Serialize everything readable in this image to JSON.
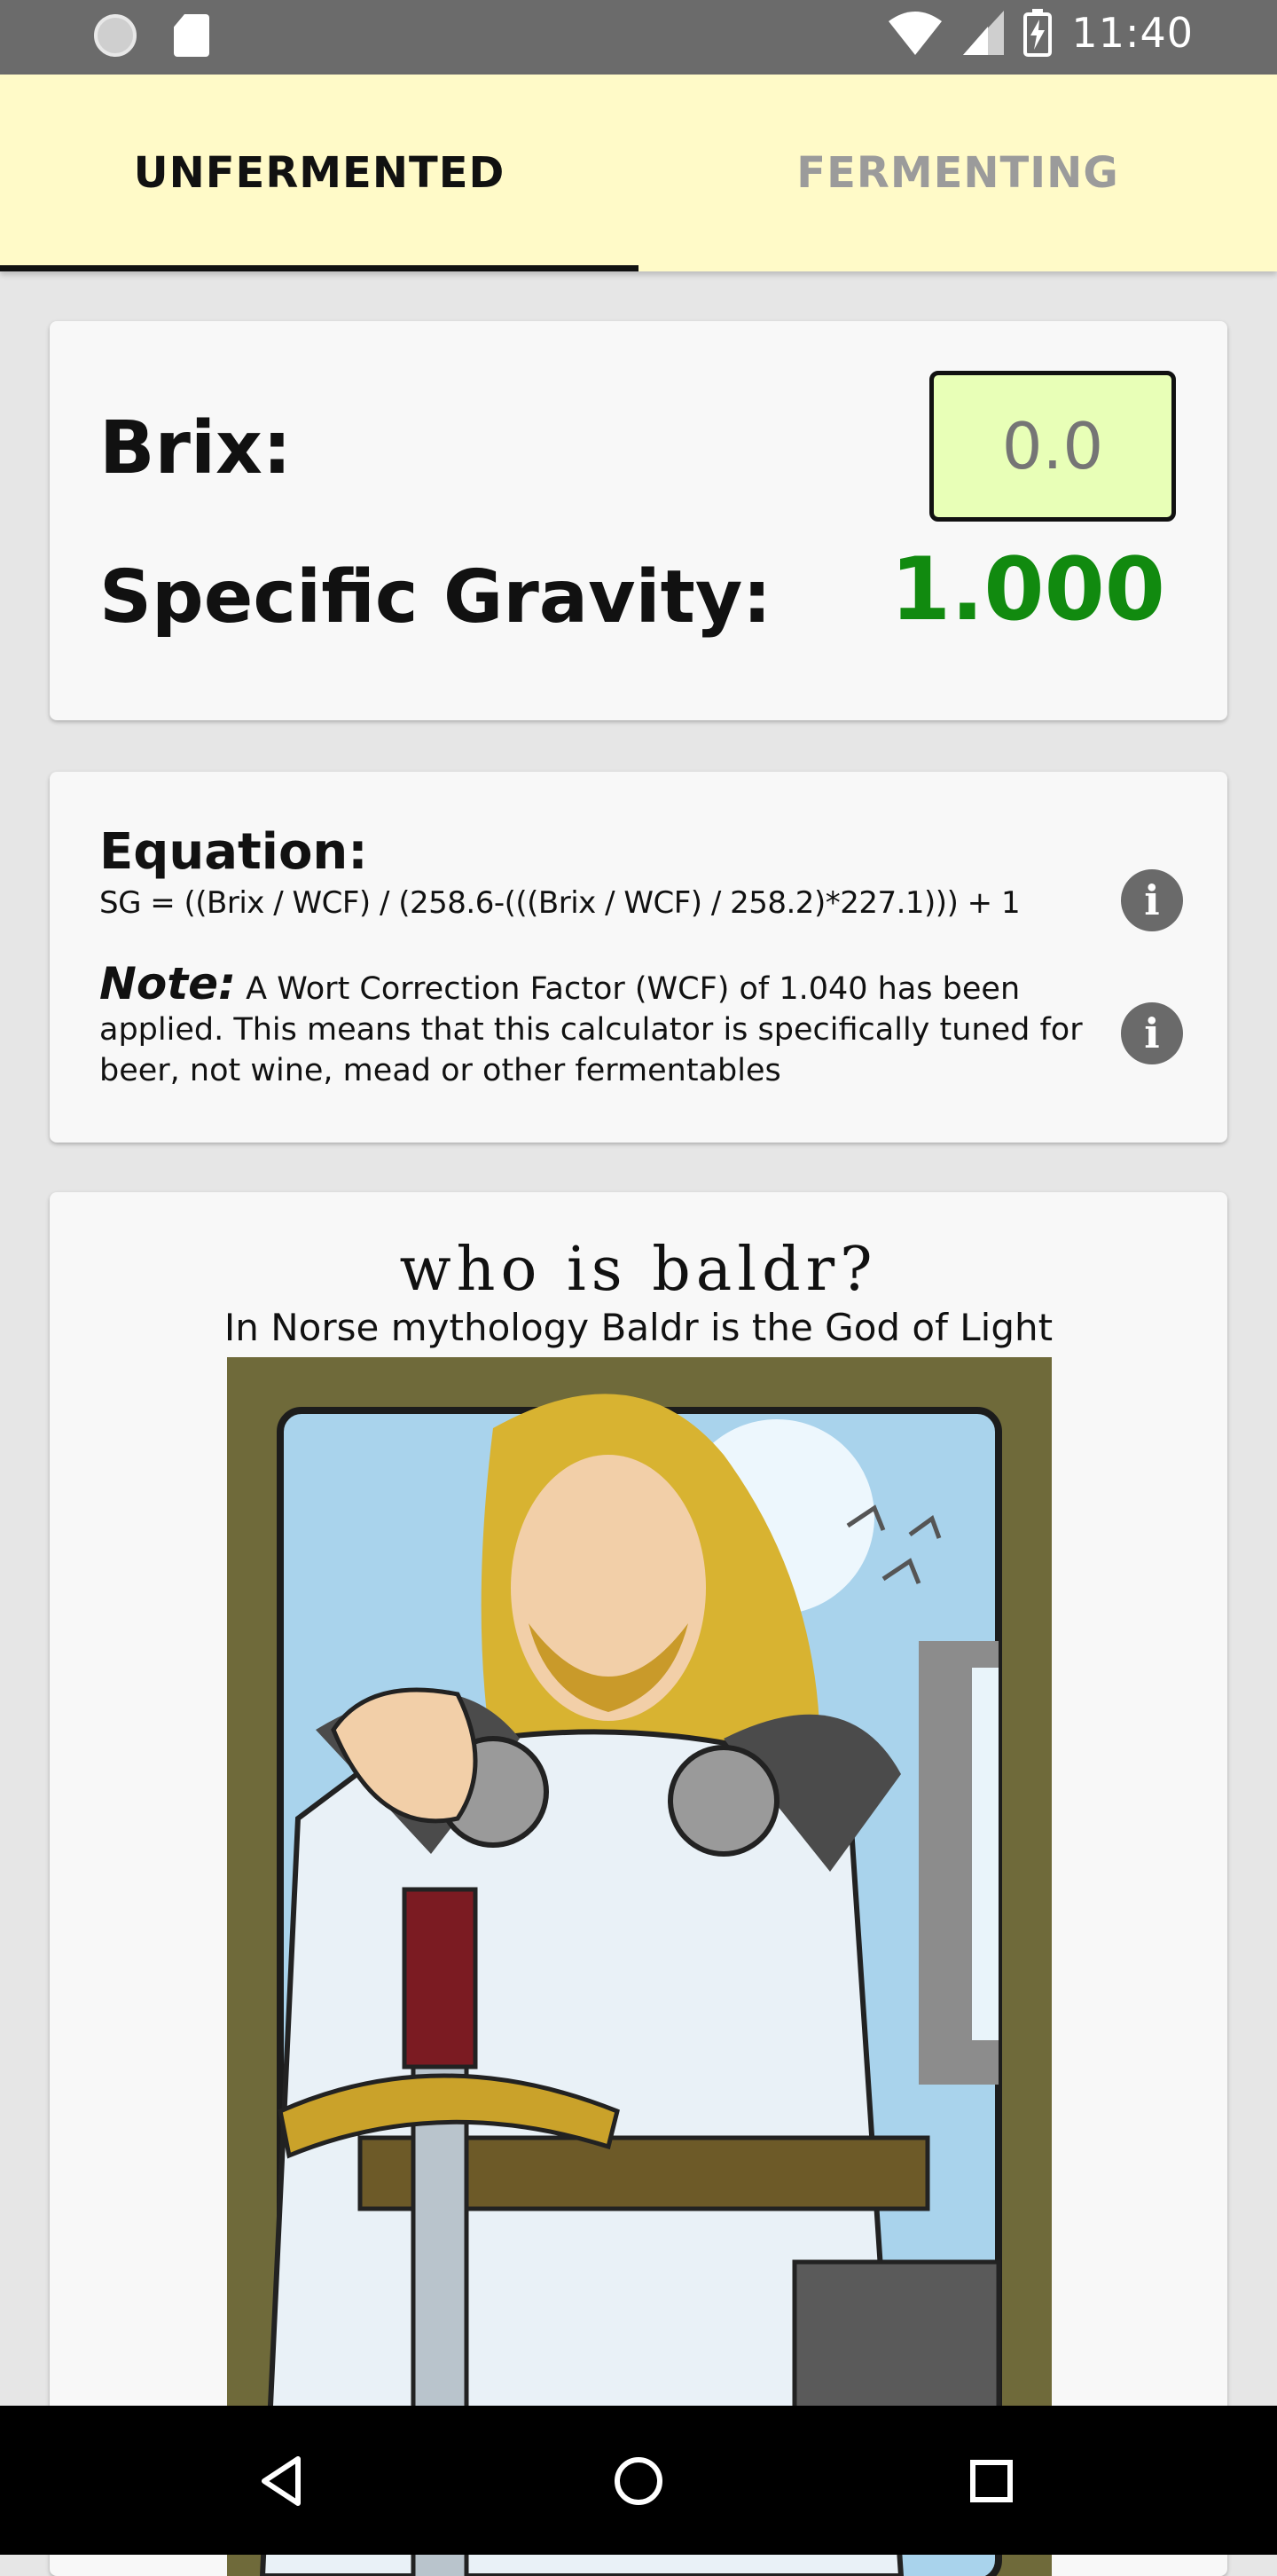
{
  "status_bar": {
    "time": "11:40"
  },
  "tabs": [
    {
      "label": "UNFERMENTED",
      "active": true
    },
    {
      "label": "FERMENTING",
      "active": false
    }
  ],
  "calculator": {
    "brix_label": "Brix:",
    "brix_placeholder": "0.0",
    "brix_value": "",
    "sg_label": "Specific Gravity:",
    "sg_value": "1.000"
  },
  "equation": {
    "title": "Equation:",
    "formula": "SG = ((Brix / WCF) / (258.6-(((Brix / WCF) / 258.2)*227.1))) + 1",
    "note_heading": "Note:",
    "note_text": " A Wort Correction Factor (WCF) of 1.040 has been applied. This means that this calculator is specifically tuned for beer, not wine, mead or other fermentables"
  },
  "baldr": {
    "title": "who is baldr?",
    "subtitle": "In Norse mythology Baldr is the God of Light"
  },
  "colors": {
    "tabbar_bg": "#fffac8",
    "input_bg": "#e8ffb7",
    "sg_value": "#118a0f"
  },
  "icons": {
    "info": "info-icon",
    "nav_back": "back-triangle-icon",
    "nav_home": "home-circle-icon",
    "nav_recents": "recents-square-icon"
  }
}
